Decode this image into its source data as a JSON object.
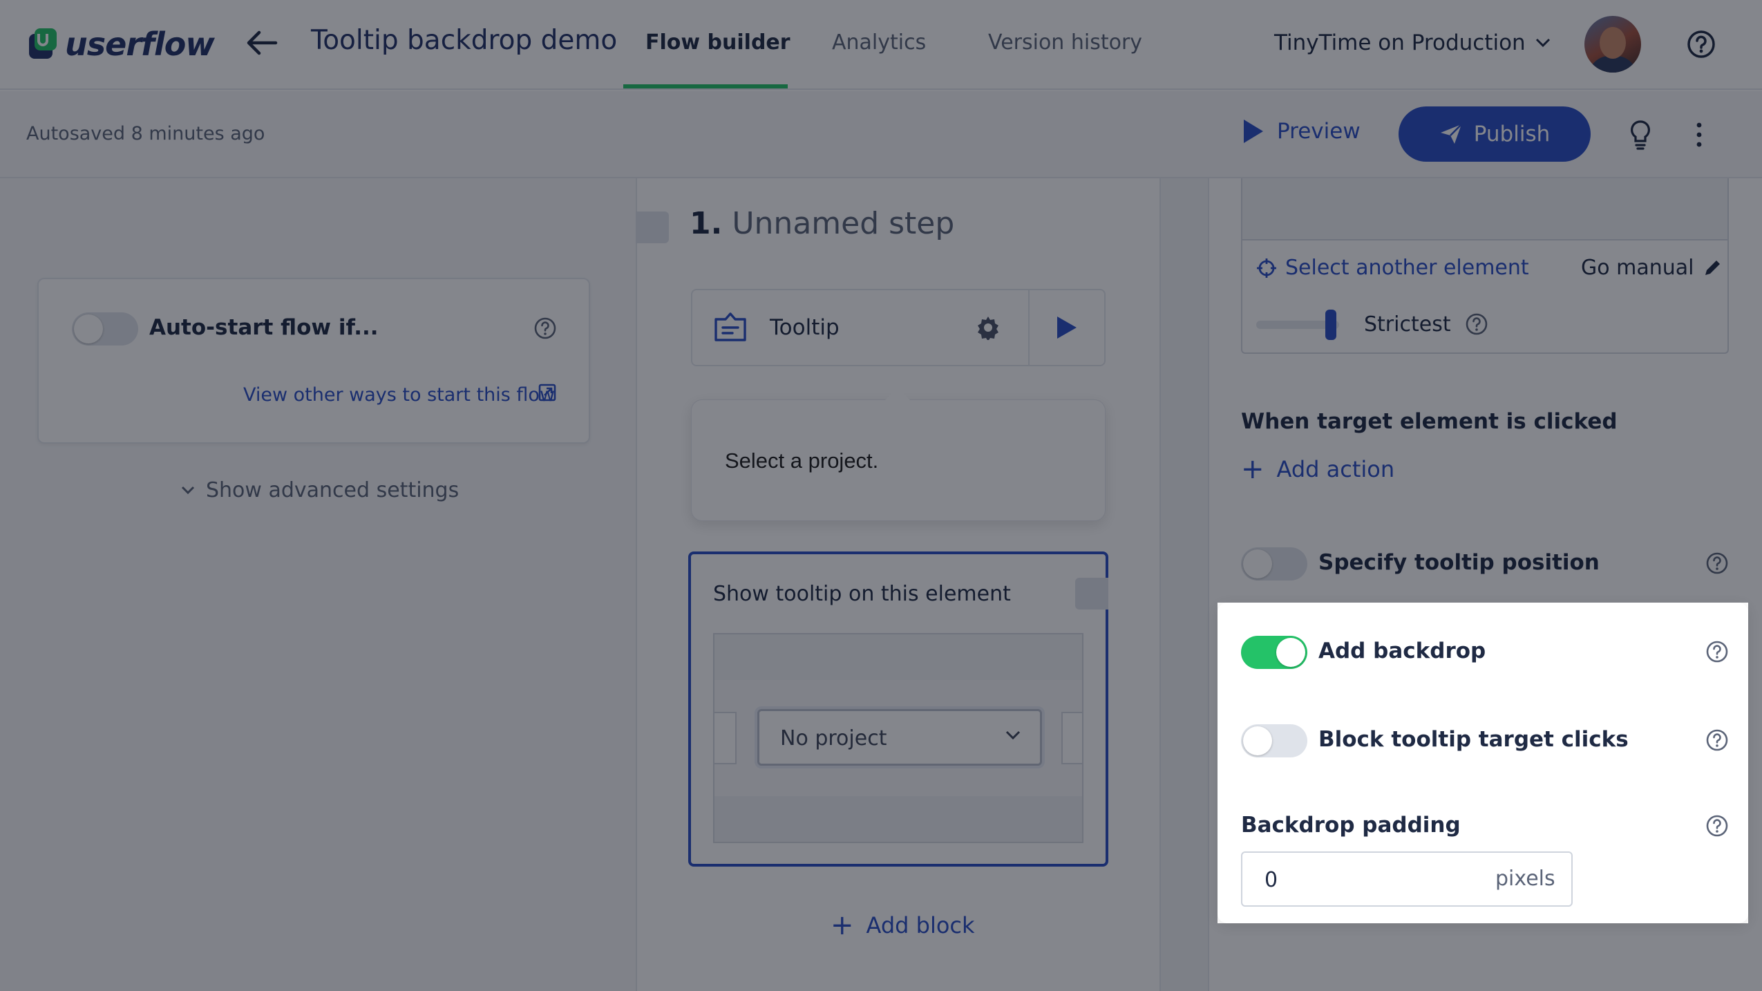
{
  "header": {
    "logo_text": "userflow",
    "flow_title": "Tooltip backdrop demo",
    "tabs": [
      {
        "label": "Flow builder",
        "active": true
      },
      {
        "label": "Analytics",
        "active": false
      },
      {
        "label": "Version history",
        "active": false
      }
    ],
    "environment": "TinyTime on Production"
  },
  "toolbar": {
    "autosave": "Autosaved 8 minutes ago",
    "preview_label": "Preview",
    "publish_label": "Publish"
  },
  "start": {
    "auto_start_label": "Auto-start flow if...",
    "auto_start_enabled": false,
    "other_ways_link": "View other ways to start this flow",
    "advanced_label": "Show advanced settings"
  },
  "step": {
    "number": "1.",
    "title": "Unnamed step",
    "block_type": "Tooltip",
    "bubble_text": "Select a project.",
    "element_title": "Show tooltip on this element",
    "select_value": "No project",
    "add_block_label": "Add block"
  },
  "target": {
    "select_another": "Select another element",
    "go_manual": "Go manual",
    "strictness": "Strictest",
    "clicked_heading": "When target element is clicked",
    "add_action": "Add action",
    "specify_position_label": "Specify tooltip position",
    "specify_position_enabled": false
  },
  "backdrop": {
    "add_backdrop_label": "Add backdrop",
    "add_backdrop_enabled": true,
    "block_clicks_label": "Block tooltip target clicks",
    "block_clicks_enabled": false,
    "padding_label": "Backdrop padding",
    "padding_value": "0",
    "padding_unit": "pixels"
  },
  "colors": {
    "accent": "#2a4ec4",
    "toggle_on": "#24c268",
    "tab_underline": "#24c268",
    "text_dark": "#1f2a44"
  }
}
